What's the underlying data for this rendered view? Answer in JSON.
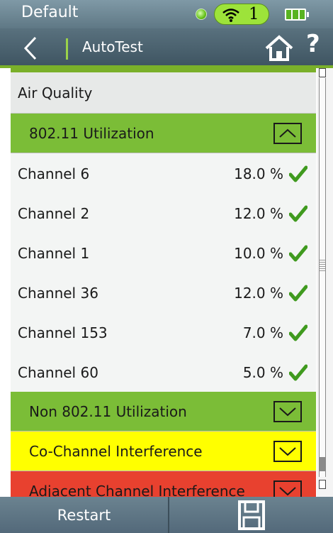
{
  "status": {
    "profile": "Default",
    "wifi_count": "1",
    "link_status_color": "#66c21a",
    "battery_color": "#59b321"
  },
  "nav": {
    "title": "AutoTest",
    "help_label": "?",
    "back_icon": "chevron-left-icon",
    "home_icon": "home-icon"
  },
  "section": {
    "title": "Air Quality"
  },
  "groups": {
    "utilization": {
      "label": "802.11 Utilization",
      "expanded": true,
      "color": "#7bbd37"
    },
    "non_utilization": {
      "label": "Non 802.11 Utilization",
      "expanded": false,
      "color": "#7bbd37"
    },
    "co_channel": {
      "label": "Co-Channel Interference",
      "expanded": false,
      "color": "#ffff00"
    },
    "adjacent": {
      "label": "Adjacent Channel Interference",
      "expanded": false,
      "color": "#e8412f"
    }
  },
  "channels": [
    {
      "name": "Channel 6",
      "value": "18.0 %",
      "status": "pass"
    },
    {
      "name": "Channel 2",
      "value": "12.0 %",
      "status": "pass"
    },
    {
      "name": "Channel 1",
      "value": "10.0 %",
      "status": "pass"
    },
    {
      "name": "Channel 36",
      "value": "12.0 %",
      "status": "pass"
    },
    {
      "name": "Channel 153",
      "value": "7.0 %",
      "status": "pass"
    },
    {
      "name": "Channel 60",
      "value": "5.0 %",
      "status": "pass"
    }
  ],
  "footer": {
    "restart_label": "Restart",
    "save_icon": "save-icon"
  },
  "colors": {
    "accent_green": "#7ab02a",
    "check_green": "#3f9a1e"
  }
}
